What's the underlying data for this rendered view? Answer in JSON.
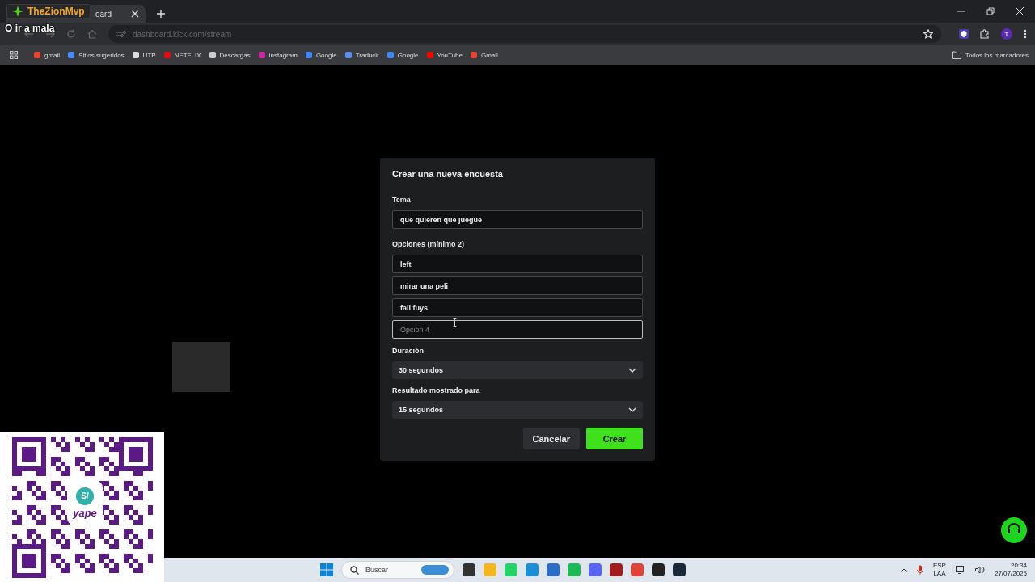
{
  "stream_overlay": {
    "channel_name": "TheZionMvp",
    "caption": "O ir a mala",
    "qr_badge": "S/",
    "qr_brand": "yape"
  },
  "browser": {
    "tab_title": "oard",
    "address": "dashboard.kick.com/stream",
    "profile_initial": "T",
    "bookmarks": [
      {
        "label": "gmail",
        "color": "#ea4335"
      },
      {
        "label": "Sitios sugeridos",
        "color": "#4a8af4"
      },
      {
        "label": "UTP",
        "color": "#dddddd"
      },
      {
        "label": "NETFLIX",
        "color": "#e50914"
      },
      {
        "label": "Descargas",
        "color": "#cccccc"
      },
      {
        "label": "instagram",
        "color": "#d6249f"
      },
      {
        "label": "Google",
        "color": "#4285f4"
      },
      {
        "label": "Traducir",
        "color": "#5b8def"
      },
      {
        "label": "Google",
        "color": "#4285f4"
      },
      {
        "label": "YouTube",
        "color": "#ff0000"
      },
      {
        "label": "Gmail",
        "color": "#ea4335"
      }
    ],
    "all_bookmarks": "Todos los marcadores"
  },
  "poll_dialog": {
    "title": "Crear una nueva encuesta",
    "topic_label": "Tema",
    "topic_value": "que quieren que juegue",
    "options_label": "Opciones (mínimo 2)",
    "options": [
      {
        "value": "left",
        "focused": false
      },
      {
        "value": "mirar una peli",
        "focused": false
      },
      {
        "value": "fall fuys",
        "focused": false
      },
      {
        "placeholder": "Opción 4",
        "focused": true
      }
    ],
    "duration_label": "Duración",
    "duration_value": "30 segundos",
    "result_label": "Resultado mostrado para",
    "result_value": "15 segundos",
    "buttons": [
      {
        "label": "Cancelar",
        "kind": "secondary"
      },
      {
        "label": "Crear",
        "kind": "primary"
      }
    ]
  },
  "taskbar": {
    "search_placeholder": "Buscar",
    "language": "ESP",
    "layout": "LAA",
    "time": "20:34",
    "date": "27/07/2025"
  }
}
